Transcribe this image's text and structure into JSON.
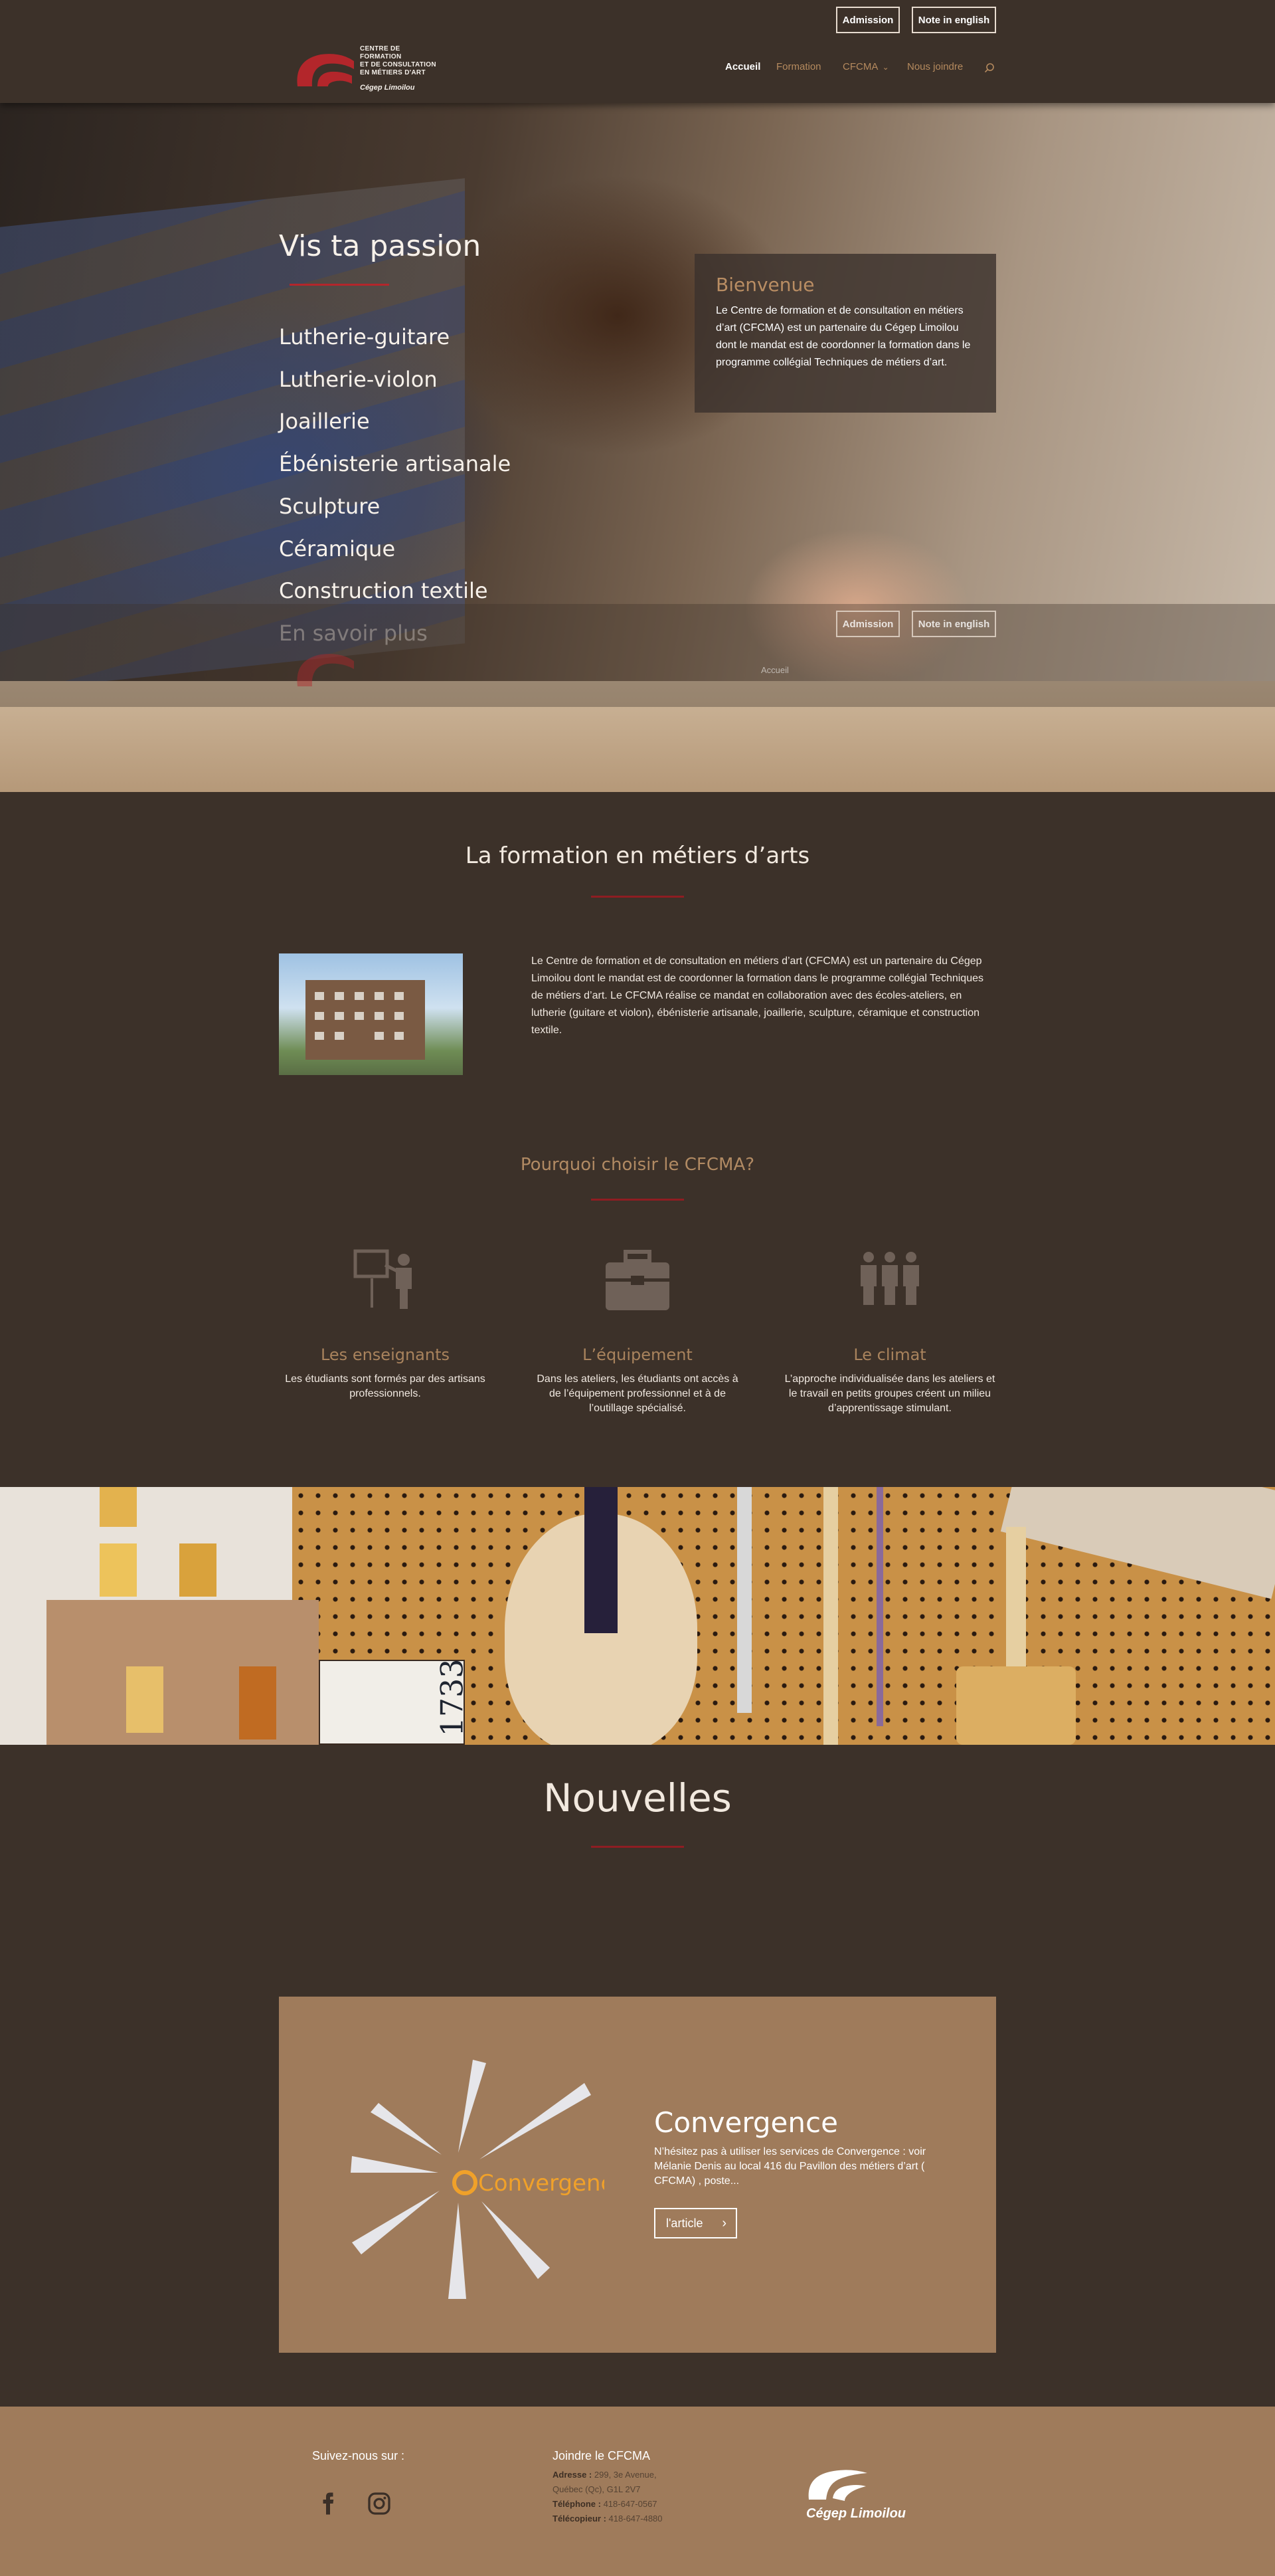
{
  "header": {
    "admission": "Admission",
    "english": "Note in english",
    "logo_lines": [
      "Centre de formation",
      "et de consultation",
      "en métiers d'art"
    ],
    "logo_sub": "Cégep Limoilou",
    "nav": [
      "Accueil",
      "Formation",
      "CFCMA",
      "Nous joindre"
    ],
    "chevron": "⌄"
  },
  "hero": {
    "title": "Vis ta passion",
    "items": [
      "Lutherie-guitare",
      "Lutherie-violon",
      "Joaillerie",
      "Ébénisterie artisanale",
      "Sculpture",
      "Céramique",
      "Construction textile",
      "En savoir plus"
    ],
    "welcome_title": "Bienvenue",
    "welcome_text": "Le Centre de formation et de consultation en métiers d’art (CFCMA) est un partenaire du Cégep Limoilou dont le mandat est de coordonner la formation dans le programme collégial Techniques de métiers d’art."
  },
  "formation": {
    "title": "La formation en métiers d’arts",
    "text": "Le Centre de formation et de consultation en métiers d’art (CFCMA) est un partenaire du Cégep Limoilou dont le mandat est de coordonner la formation dans le programme collégial Techniques de métiers d’art. Le CFCMA réalise ce mandat en collaboration avec des écoles-ateliers, en lutherie (guitare et violon), ébénisterie artisanale, joaillerie, sculpture, céramique et construction textile.",
    "why_title": "Pourquoi choisir le CFCMA?",
    "features": [
      {
        "icon": "teacher-icon",
        "title": "Les enseignants",
        "text": "Les étudiants sont formés par des artisans professionnels."
      },
      {
        "icon": "toolbox-icon",
        "title": "L’équipement",
        "text": "Dans les ateliers, les étudiants ont accès à de l’équipement professionnel et à de l’outillage spécialisé."
      },
      {
        "icon": "group-icon",
        "title": "Le climat",
        "text": "L’approche individualisée dans les ateliers et le travail en petits groupes créent un milieu d’apprentissage stimulant."
      }
    ]
  },
  "workshop": {
    "card_text": "1733"
  },
  "news": {
    "title": "Nouvelles",
    "card_title": "Convergence",
    "card_text": "N’hésitez pas à utiliser les services de Convergence : voir Mélanie Denis au local 416 du Pavillon des métiers d’art ( CFCMA) , poste...",
    "button": "l'article",
    "logo_text": "Convergence"
  },
  "footer": {
    "follow": "Suivez-nous sur :",
    "join": "Joindre le CFCMA",
    "address_label": "Adresse :",
    "address": "299, 3e Avenue,",
    "city": "Québec (Qc), G1L 2V7",
    "phone_label": "Téléphone :",
    "phone": "418-647-0567",
    "fax_label": "Télécopieur :",
    "fax": "418-647-4880",
    "cegep": "Cégep Limoilou"
  },
  "colors": {
    "background": "#3c3129",
    "accent_red": "#b3262b",
    "tan": "#9f7b5b",
    "gold": "#b18a63"
  }
}
